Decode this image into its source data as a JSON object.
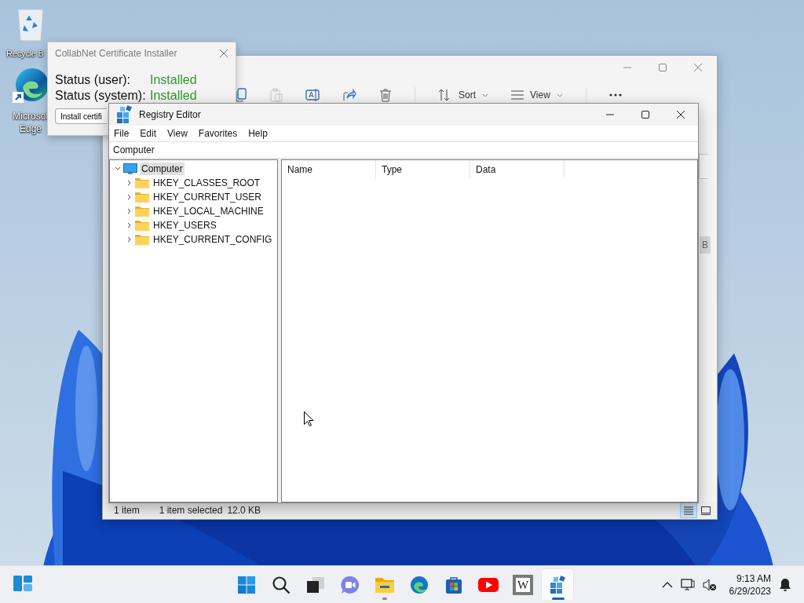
{
  "desktop_icons": [
    {
      "kind": "recycle_bin",
      "lines": [
        "Recycle B"
      ]
    },
    {
      "kind": "edge",
      "lines": [
        "Microsof",
        "Edge"
      ]
    }
  ],
  "explorer_window": {
    "toolbar": [
      {
        "kind": "copy",
        "disabled": false
      },
      {
        "kind": "paste",
        "disabled": true
      },
      {
        "kind": "rename",
        "disabled": false
      },
      {
        "kind": "share",
        "disabled": false
      },
      {
        "kind": "delete",
        "disabled": false
      }
    ],
    "sort": "Sort",
    "view": "View",
    "side_cell": "B",
    "status_bar": {
      "count": "1 item",
      "selection": "1 item selected",
      "size": "12.0 KB",
      "view_modes": [
        {
          "kind": "details",
          "selected": true
        },
        {
          "kind": "tiles",
          "selected": false
        }
      ]
    }
  },
  "certificate_dialog": {
    "title": "CollabNet Certificate Installer",
    "rows": [
      {
        "label": "Status (user):",
        "value": "Installed"
      },
      {
        "label": "Status (system):",
        "value": "Installed"
      }
    ],
    "button": "Install certifi"
  },
  "registry_editor": {
    "title": "Registry Editor",
    "menu": [
      "File",
      "Edit",
      "View",
      "Favorites",
      "Help"
    ],
    "address": "Computer",
    "tree": {
      "label": "Computer",
      "expanded": true,
      "selected": true,
      "children": [
        {
          "label": "HKEY_CLASSES_ROOT",
          "expanded": false,
          "selected": false
        },
        {
          "label": "HKEY_CURRENT_USER",
          "expanded": false,
          "selected": false
        },
        {
          "label": "HKEY_LOCAL_MACHINE",
          "expanded": false,
          "selected": false
        },
        {
          "label": "HKEY_USERS",
          "expanded": false,
          "selected": false
        },
        {
          "label": "HKEY_CURRENT_CONFIG",
          "expanded": false,
          "selected": false
        }
      ]
    },
    "columns": [
      "Name",
      "Type",
      "Data"
    ]
  },
  "taskbar": {
    "apps": [
      {
        "kind": "start",
        "running": false,
        "selected": false
      },
      {
        "kind": "search",
        "running": false,
        "selected": false
      },
      {
        "kind": "taskview",
        "running": false,
        "selected": false
      },
      {
        "kind": "chat",
        "running": false,
        "selected": false
      },
      {
        "kind": "explorer",
        "running": true,
        "selected": false
      },
      {
        "kind": "edge",
        "running": false,
        "selected": false
      },
      {
        "kind": "store",
        "running": false,
        "selected": false
      },
      {
        "kind": "youtube",
        "running": false,
        "selected": false
      },
      {
        "kind": "wiki",
        "label": "W",
        "running": false,
        "selected": false
      },
      {
        "kind": "regedit",
        "running": true,
        "selected": true
      }
    ],
    "clock": {
      "time": "9:13 AM",
      "date": "6/29/2023"
    }
  }
}
